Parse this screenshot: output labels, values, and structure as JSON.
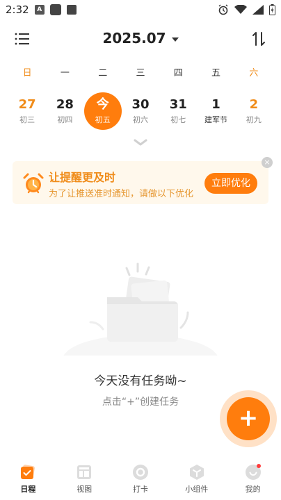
{
  "status": {
    "time": "2:32"
  },
  "header": {
    "month": "2025.07"
  },
  "week": {
    "days": [
      "日",
      "一",
      "二",
      "三",
      "四",
      "五",
      "六"
    ]
  },
  "dates": [
    {
      "num": "27",
      "lunar": "初三"
    },
    {
      "num": "28",
      "lunar": "初四"
    },
    {
      "num": "今",
      "lunar": "初五"
    },
    {
      "num": "30",
      "lunar": "初六"
    },
    {
      "num": "31",
      "lunar": "初七"
    },
    {
      "num": "1",
      "lunar": "建军节"
    },
    {
      "num": "2",
      "lunar": "初九"
    }
  ],
  "reminder": {
    "title": "让提醒更及时",
    "subtitle": "为了让推送准时通知，请做以下优化",
    "cta": "立即优化",
    "close": "×"
  },
  "empty": {
    "title": "今天没有任务呦~",
    "hint": "点击“+”创建任务"
  },
  "fab": {
    "label": "+"
  },
  "nav": [
    {
      "label": "日程"
    },
    {
      "label": "视图"
    },
    {
      "label": "打卡"
    },
    {
      "label": "小组件"
    },
    {
      "label": "我的"
    }
  ],
  "colors": {
    "accent": "#ff7d0d",
    "weekend": "#f08c1a",
    "reminder_bg": "#fff8ec"
  }
}
